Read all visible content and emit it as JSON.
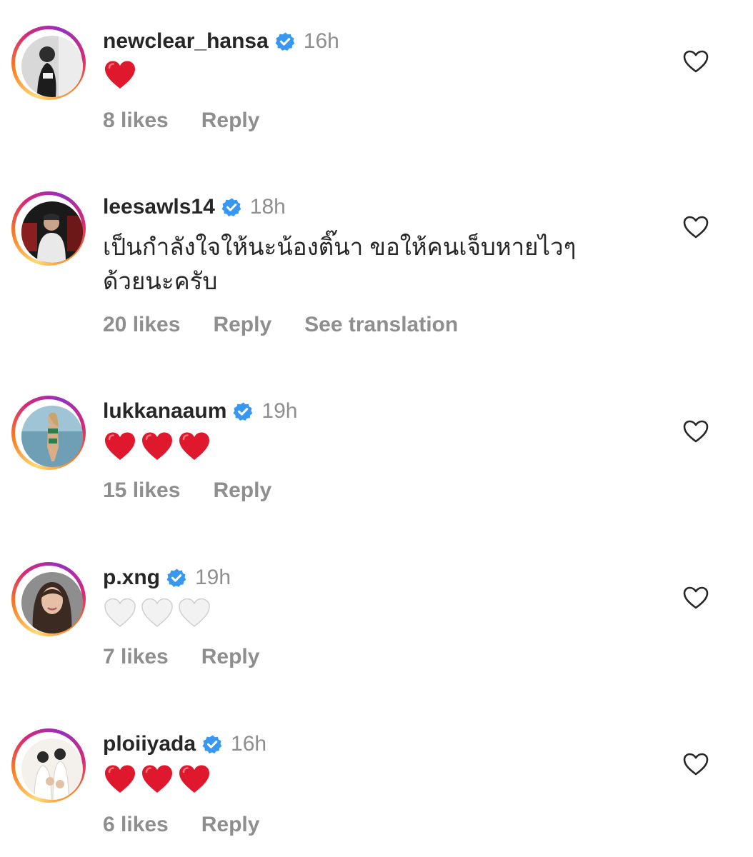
{
  "comments": [
    {
      "username": "newclear_hansa",
      "time": "16h",
      "hearts": "❤️",
      "likes": "8 likes",
      "reply": "Reply"
    },
    {
      "username": "leesawls14",
      "time": "18h",
      "text_line1": "เป็นกำลังใจให้นะน้องติ๊นา ขอให้คนเจ็บหายไวๆ",
      "text_line2": "ด้วยนะครับ",
      "likes": "20 likes",
      "reply": "Reply",
      "translate": "See translation"
    },
    {
      "username": "lukkanaaum",
      "time": "19h",
      "hearts": "❤️❤️❤️",
      "likes": "15 likes",
      "reply": "Reply"
    },
    {
      "username": "p.xng",
      "time": "19h",
      "hearts": "🤍🤍🤍",
      "likes": "7 likes",
      "reply": "Reply"
    },
    {
      "username": "ploiiyada",
      "time": "16h",
      "hearts": "❤️❤️❤️",
      "likes": "6 likes",
      "reply": "Reply"
    }
  ],
  "icons": {
    "verified": "verified-badge-icon",
    "like": "heart-outline-icon"
  },
  "colors": {
    "verified_blue": "#3897f0",
    "text_primary": "#262626",
    "text_secondary": "#8e8e8e",
    "heart_red": "#e0182d"
  }
}
